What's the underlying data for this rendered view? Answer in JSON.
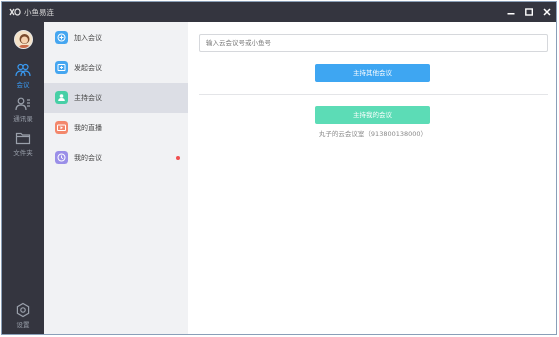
{
  "window": {
    "title": "小鱼易连"
  },
  "nav": {
    "items": [
      {
        "id": "meeting",
        "label": "会议",
        "icon": "people-icon",
        "active": true
      },
      {
        "id": "contacts",
        "label": "通讯录",
        "icon": "contacts-icon",
        "active": false
      },
      {
        "id": "files",
        "label": "文件夹",
        "icon": "folder-icon",
        "active": false
      }
    ],
    "settings_label": "设置"
  },
  "sidebar": {
    "items": [
      {
        "label": "加入会议",
        "icon": "join-icon",
        "color": "#45a6f0"
      },
      {
        "label": "发起会议",
        "icon": "start-icon",
        "color": "#45a6f0"
      },
      {
        "label": "主持会议",
        "icon": "host-icon",
        "color": "#47cfa6",
        "active": true
      },
      {
        "label": "我的直播",
        "icon": "live-icon",
        "color": "#f3876b"
      },
      {
        "label": "我的会议",
        "icon": "clock-icon",
        "color": "#9a8fe8",
        "badge_dot": true
      }
    ]
  },
  "main": {
    "search_placeholder": "输入云会议号或小鱼号",
    "host_other_label": "主持其他会议",
    "host_mine_label": "主持我的会议",
    "room_info": "丸子的云会议室（913800138000）"
  },
  "colors": {
    "titlebar": "#34353f",
    "accent_blue": "#3ea6f2",
    "accent_green": "#5cdcb6"
  }
}
